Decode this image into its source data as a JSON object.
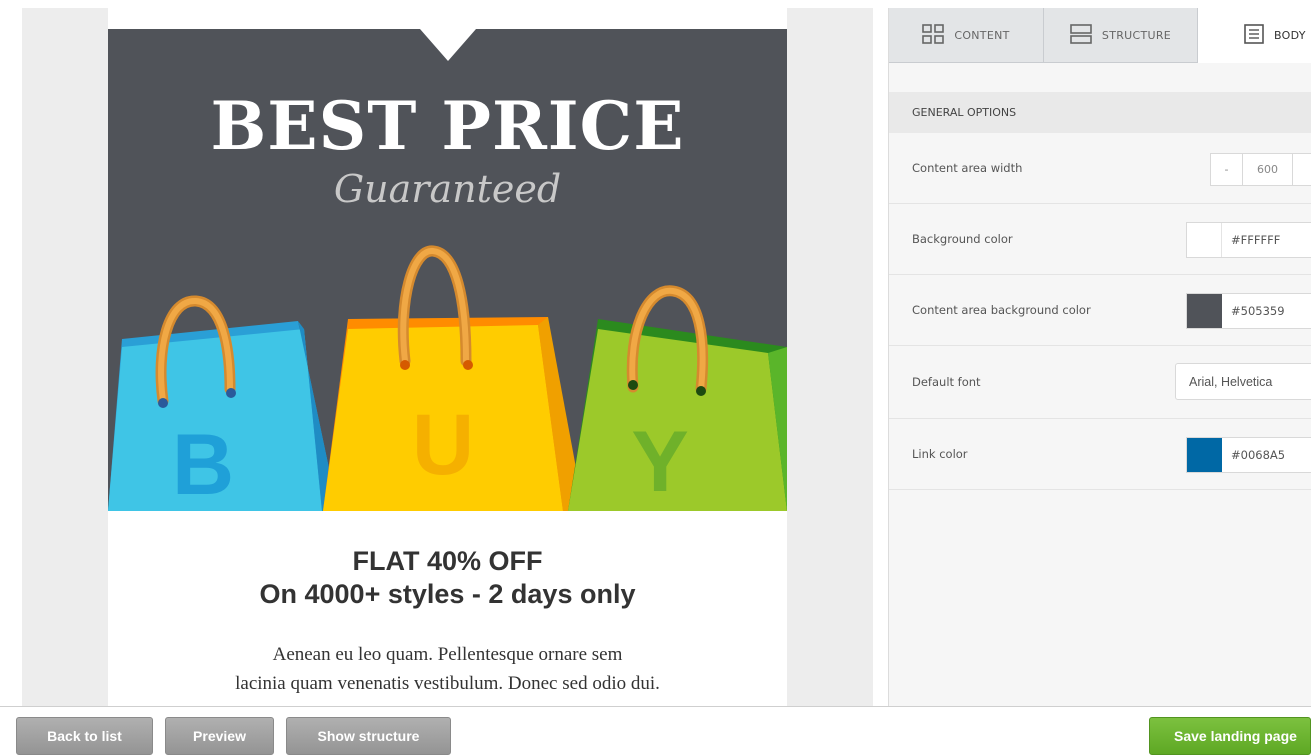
{
  "hero": {
    "title": "BEST PRICE",
    "subtitle": "Guaranteed",
    "bag_letters": [
      "B",
      "U",
      "Y"
    ]
  },
  "offer": {
    "title_line1": "FLAT 40% OFF",
    "title_line2": "On 4000+ styles - 2 days only",
    "body_line1": "Aenean eu leo quam. Pellentesque ornare sem",
    "body_line2": "lacinia quam venenatis vestibulum. Donec sed odio dui."
  },
  "tabs": [
    {
      "label": "CONTENT",
      "icon": "grid-icon"
    },
    {
      "label": "STRUCTURE",
      "icon": "rows-icon"
    },
    {
      "label": "BODY",
      "icon": "document-icon"
    }
  ],
  "general_options": {
    "heading": "GENERAL OPTIONS",
    "content_area_width": {
      "label": "Content area width",
      "decrement": "-",
      "value": "600"
    },
    "background_color": {
      "label": "Background color",
      "swatch": "#FFFFFF",
      "value": "#FFFFFF"
    },
    "content_area_background_color": {
      "label": "Content area background color",
      "swatch": "#505359",
      "value": "#505359"
    },
    "default_font": {
      "label": "Default font",
      "value": "Arial, Helvetica"
    },
    "link_color": {
      "label": "Link color",
      "swatch": "#0068A5",
      "value": "#0068A5"
    }
  },
  "toolbar": {
    "back_label": "Back to list",
    "preview_label": "Preview",
    "structure_label": "Show structure",
    "save_label": "Save landing page"
  },
  "colors": {
    "hero_bg": "#505359",
    "save_green": "#6bb52f",
    "button_gray": "#a3a3a3",
    "bag_blue": "#3fc5e6",
    "bag_yellow": "#ffcc00",
    "bag_green": "#9cc92a"
  }
}
